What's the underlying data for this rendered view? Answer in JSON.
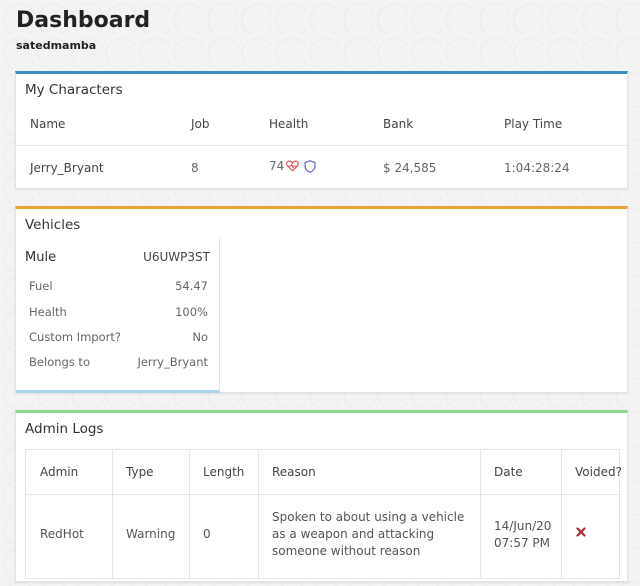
{
  "header": {
    "title": "Dashboard",
    "username": "satedmamba"
  },
  "characters": {
    "title": "My Characters",
    "columns": [
      "Name",
      "Job",
      "Health",
      "Bank",
      "Play Time"
    ],
    "rows": [
      {
        "name": "Jerry_Bryant",
        "job": "8",
        "health": "74",
        "bank": "$ 24,585",
        "play_time": "1:04:28:24"
      }
    ]
  },
  "vehicles": {
    "title": "Vehicles",
    "items": [
      {
        "model": "Mule",
        "plate": "U6UWP3ST",
        "fields": [
          {
            "label": "Fuel",
            "value": "54.47"
          },
          {
            "label": "Health",
            "value": "100%"
          },
          {
            "label": "Custom Import?",
            "value": "No"
          },
          {
            "label": "Belongs to",
            "value": "Jerry_Bryant"
          }
        ]
      }
    ]
  },
  "admin_logs": {
    "title": "Admin Logs",
    "columns": [
      "Admin",
      "Type",
      "Length",
      "Reason",
      "Date",
      "Voided?"
    ],
    "rows": [
      {
        "admin": "RedHot",
        "type": "Warning",
        "length": "0",
        "reason": "Spoken to about using a vehicle as a weapon and attacking someone without reason",
        "date": "14/Jun/20 07:57 PM",
        "voided_icon": "x-icon"
      }
    ]
  },
  "colors": {
    "characters_accent": "#3a90b8",
    "vehicles_accent": "#e8a43a",
    "logs_accent": "#8fd68f",
    "heart": "#d9534f",
    "shield": "#5a5ad0",
    "void_x": "#b02a2a"
  }
}
